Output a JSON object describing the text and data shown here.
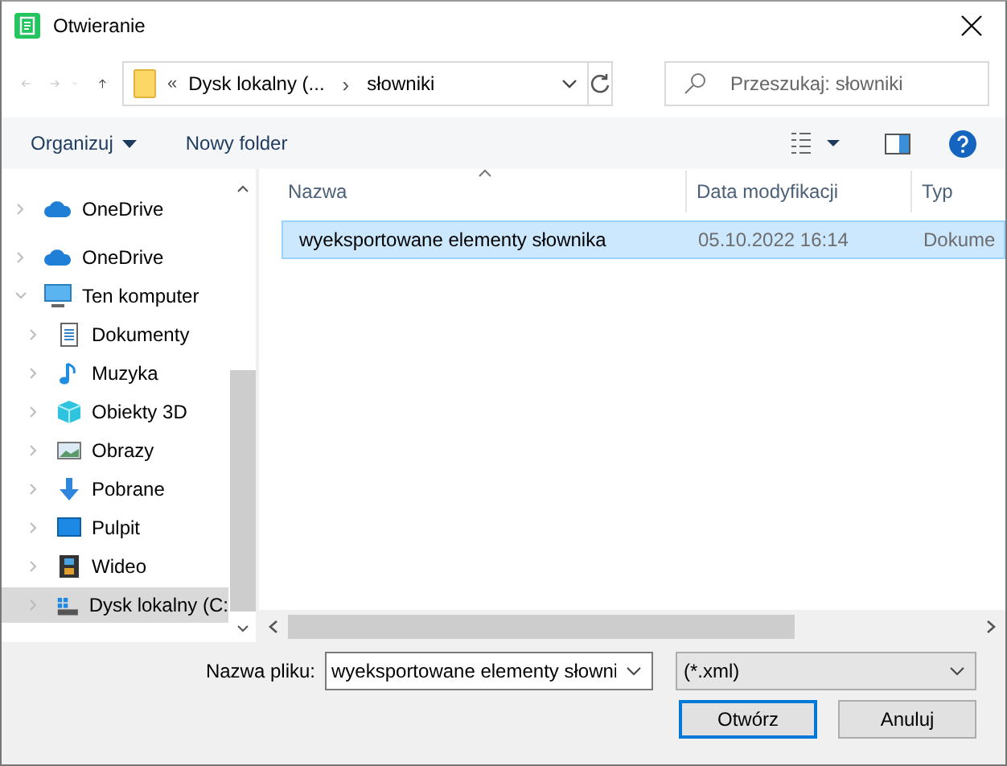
{
  "window": {
    "title": "Otwieranie"
  },
  "address": {
    "prefix": "«",
    "crumbs": [
      "Dysk lokalny (...",
      "słowniki"
    ],
    "separator": "›"
  },
  "search": {
    "placeholder": "Przeszukaj: słowniki"
  },
  "toolbar": {
    "organize": "Organizuj",
    "new_folder": "Nowy folder"
  },
  "sidebar": {
    "items": [
      {
        "label": "OneDrive",
        "kind": "cloud",
        "expanded": false,
        "selected": false
      },
      {
        "label": "OneDrive",
        "kind": "cloud",
        "expanded": false,
        "selected": false
      },
      {
        "label": "Ten komputer",
        "kind": "computer",
        "expanded": true,
        "selected": false,
        "children": [
          {
            "label": "Dokumenty",
            "kind": "document",
            "expanded": false,
            "selected": false
          },
          {
            "label": "Muzyka",
            "kind": "music",
            "expanded": false,
            "selected": false
          },
          {
            "label": "Obiekty 3D",
            "kind": "cube",
            "expanded": false,
            "selected": false
          },
          {
            "label": "Obrazy",
            "kind": "image",
            "expanded": false,
            "selected": false
          },
          {
            "label": "Pobrane",
            "kind": "download",
            "expanded": false,
            "selected": false
          },
          {
            "label": "Pulpit",
            "kind": "desktop",
            "expanded": false,
            "selected": false
          },
          {
            "label": "Wideo",
            "kind": "film",
            "expanded": false,
            "selected": false
          },
          {
            "label": "Dysk lokalny (C:",
            "kind": "drive",
            "expanded": false,
            "selected": true
          }
        ]
      }
    ]
  },
  "table": {
    "columns": [
      "Nazwa",
      "Data modyfikacji",
      "Typ"
    ],
    "rows": [
      {
        "name": "wyeksportowane elementy słownika",
        "date": "05.10.2022 16:14",
        "type": "Dokume",
        "selected": true
      }
    ]
  },
  "footer": {
    "filename_label": "Nazwa pliku:",
    "filename": "wyeksportowane elementy słowni",
    "filetype": "(*.xml)",
    "buttons": [
      "Otwórz",
      "Anuluj"
    ]
  }
}
